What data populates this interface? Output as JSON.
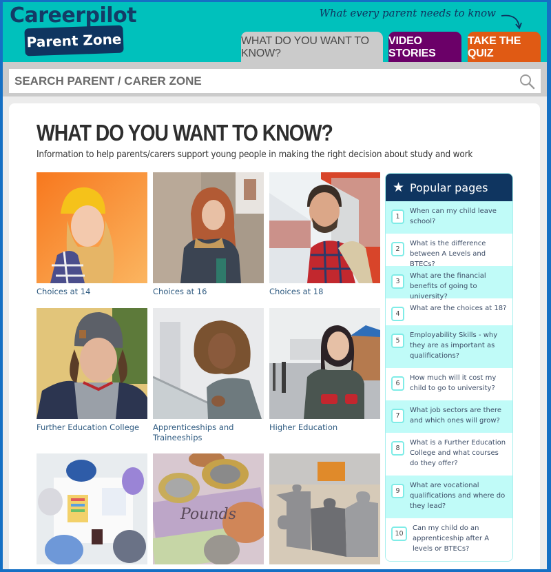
{
  "header": {
    "logo_main": "Careerpilot",
    "logo_badge": "Parent Zone",
    "tagline": "What every parent needs to know",
    "tabs": [
      {
        "label": "WHAT DO YOU WANT TO KNOW?",
        "active": true,
        "color": "#cbcbcb"
      },
      {
        "label": "VIDEO STORIES",
        "active": false,
        "color": "#6b0068"
      },
      {
        "label": "TAKE THE QUIZ",
        "active": false,
        "color": "#e05a14"
      }
    ]
  },
  "search": {
    "placeholder": "SEARCH PARENT / CARER ZONE",
    "value": "",
    "icon": "search-icon"
  },
  "main": {
    "title": "WHAT DO YOU WANT TO KNOW?",
    "subtitle": "Information to help parents/carers support young people in making the right decision about study and work",
    "cards": [
      {
        "caption": "Choices at 14",
        "image": "girl in yellow beanie against orange wall"
      },
      {
        "caption": "Choices at 16",
        "image": "red-haired girl in jacket"
      },
      {
        "caption": "Choices at 18",
        "image": "young man with backpack at train station"
      },
      {
        "caption": "Further Education College",
        "image": "young man in grey beanie"
      },
      {
        "caption": "Apprenticeships and Traineeships",
        "image": "smiling girl with curly hair"
      },
      {
        "caption": "Higher Education",
        "image": "woman with scarf holding phone"
      },
      {
        "caption": "",
        "image": "people working around a table"
      },
      {
        "caption": "",
        "image": "pound notes and coins"
      },
      {
        "caption": "",
        "image": "grey jigsaw pieces"
      }
    ]
  },
  "popular": {
    "title": "Popular pages",
    "icon": "star-icon",
    "items": [
      {
        "num": "1",
        "text": "When can my child leave school?"
      },
      {
        "num": "2",
        "text": "What is the difference between A Levels and BTECs?"
      },
      {
        "num": "3",
        "text": "What are the financial benefits of going to university?"
      },
      {
        "num": "4",
        "text": "What are the choices at 18?"
      },
      {
        "num": "5",
        "text": "Employability Skills - why they are as important as qualifications?"
      },
      {
        "num": "6",
        "text": "How much will it cost my child to go to university?"
      },
      {
        "num": "7",
        "text": "What job sectors are there and which ones will grow?"
      },
      {
        "num": "8",
        "text": "What is a Further Education College and what courses do they offer?"
      },
      {
        "num": "9",
        "text": "What are vocational qualifications and where do they lead?"
      },
      {
        "num": "10",
        "text": "Can my child do an apprenticeship after A levels or BTECs?"
      }
    ]
  },
  "colors": {
    "header_teal": "#00c1bc",
    "navy": "#0f3560",
    "purple": "#6b0068",
    "orange": "#e05a14",
    "popular_stripe": "#c0fbf8"
  }
}
